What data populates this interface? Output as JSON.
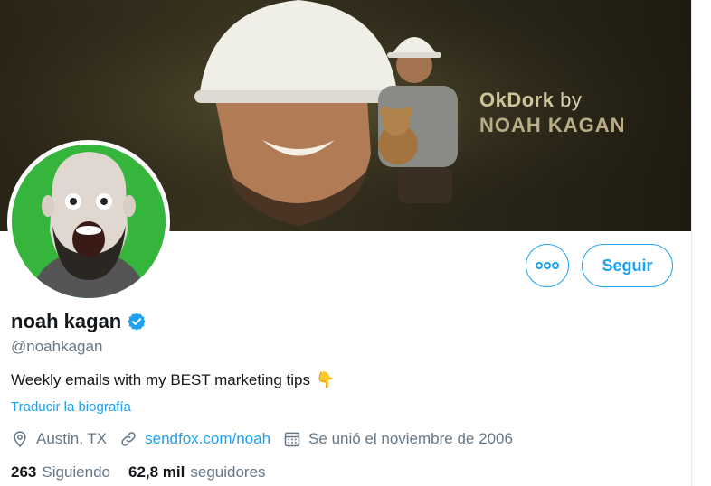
{
  "banner": {
    "title_line1": "OkDork",
    "title_by": "by",
    "title_line2": "NOAH KAGAN"
  },
  "profile": {
    "name": "noah kagan",
    "verified": true,
    "handle": "@noahkagan",
    "bio": "Weekly emails with my BEST marketing tips",
    "bio_emoji": "👇",
    "translate_label": "Traducir la biografía",
    "location": "Austin, TX",
    "website": "sendfox.com/noah",
    "joined": "Se unió el noviembre de 2006"
  },
  "stats": {
    "following_count": "263",
    "following_label": "Siguiendo",
    "followers_count": "62,8 mil",
    "followers_label": "seguidores"
  },
  "actions": {
    "more_icon": "more-icon",
    "follow_label": "Seguir"
  },
  "colors": {
    "accent": "#1da1f2",
    "secondary_text": "#657786",
    "avatar_bg": "#35b53b"
  }
}
